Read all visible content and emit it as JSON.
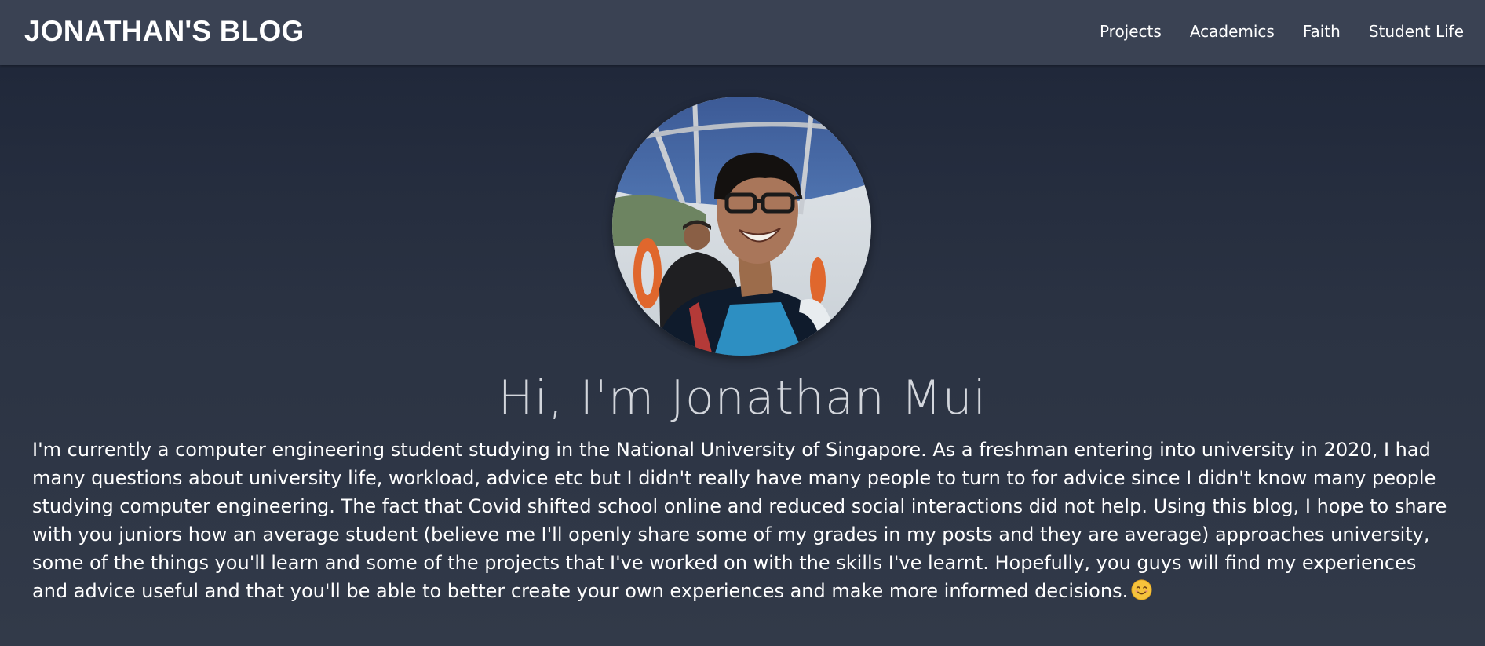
{
  "navbar": {
    "brand": "JONATHAN'S BLOG",
    "links": [
      {
        "label": "Projects"
      },
      {
        "label": "Academics"
      },
      {
        "label": "Faith"
      },
      {
        "label": "Student Life"
      }
    ]
  },
  "hero": {
    "headline": "Hi, I'm Jonathan Mui",
    "intro": "I'm currently a computer engineering student studying in the National University of Singapore. As a freshman entering into university in 2020, I had many questions about university life, workload, advice etc but I didn't really have many people to turn to for advice since I didn't know many people studying computer engineering. The fact that Covid shifted school online and reduced social interactions did not help. Using this blog, I hope to share with you juniors how an average student (believe me I'll openly share some of my grades in my posts and they are average) approaches university, some of the things you'll learn and some of the projects that I've worked on with the skills I've learnt. Hopefully, you guys will find my experiences and advice useful and that you'll be able to better create your own experiences and make more informed decisions.",
    "emoji_icon": "smiling-face-icon"
  },
  "colors": {
    "navbar_bg": "#3a4253",
    "page_bg": "#272e3d",
    "headline_text": "#d3d6dc",
    "body_text": "#ffffff"
  }
}
